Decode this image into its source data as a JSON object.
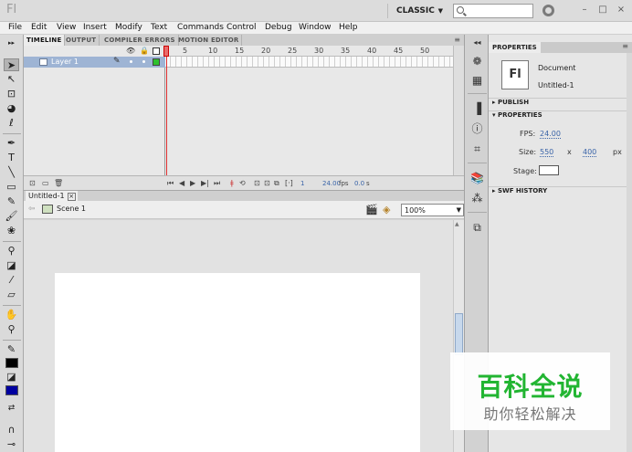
{
  "app": {
    "logo": "Fl",
    "workspace": "CLASSIC",
    "search_placeholder": "",
    "window_controls": {
      "minimize": "–",
      "maximize": "□",
      "close": "×"
    }
  },
  "menu": [
    "File",
    "Edit",
    "View",
    "Insert",
    "Modify",
    "Text",
    "Commands",
    "Control",
    "Debug",
    "Window",
    "Help"
  ],
  "timeline": {
    "tabs": [
      "TIMELINE",
      "OUTPUT",
      "COMPILER ERRORS",
      "MOTION EDITOR"
    ],
    "frame_numbers": [
      "5",
      "10",
      "15",
      "20",
      "25",
      "30",
      "35",
      "40",
      "45",
      "50"
    ],
    "layer": {
      "name": "Layer 1"
    },
    "current_frame": "1",
    "fps": "24.00",
    "fps_unit": "fps",
    "elapsed": "0.0",
    "elapsed_unit": "s"
  },
  "document": {
    "tab_title": "Untitled-1",
    "scene": "Scene 1",
    "zoom": "100%"
  },
  "properties": {
    "tab": "PROPERTIES",
    "doc_type": "Document",
    "doc_name": "Untitled-1",
    "icon_text": "Fl",
    "sections": {
      "publish": "PUBLISH",
      "properties": "PROPERTIES",
      "swf_history": "SWF HISTORY"
    },
    "fps_label": "FPS:",
    "fps_value": "24.00",
    "size_label": "Size:",
    "width": "550",
    "x_sep": "x",
    "height": "400",
    "unit": "px",
    "stage_label": "Stage:",
    "stage_color": "#ffffff"
  },
  "watermark": {
    "main": "百科全说",
    "sub": "助你轻松解决"
  }
}
